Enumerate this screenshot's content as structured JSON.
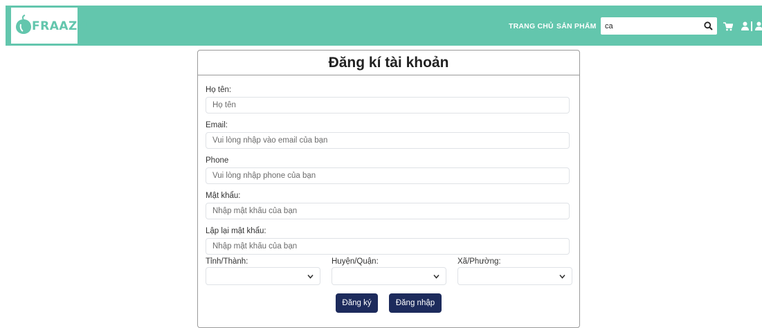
{
  "header": {
    "logo_text": "FRAAZO",
    "nav": {
      "home": "TRANG CHỦ",
      "products": "SẢN PHẨM"
    },
    "search": {
      "value": "ca"
    },
    "brand_color": "#63c6ad"
  },
  "form": {
    "title": "Đăng kí tài khoản",
    "fields": {
      "name": {
        "label": "Họ tên:",
        "placeholder": "Họ tên"
      },
      "email": {
        "label": "Email:",
        "placeholder": "Vui lòng nhập vào email của bạn"
      },
      "phone": {
        "label": "Phone",
        "placeholder": "Vui lòng nhập phone của bạn"
      },
      "password": {
        "label": "Mật khẩu:",
        "placeholder": "Nhập mật khẩu của bạn"
      },
      "confirm_password": {
        "label": "Lập lại mật khẩu:",
        "placeholder": "Nhập mật khẩu của bạn"
      }
    },
    "selects": {
      "province": {
        "label": "Tỉnh/Thành:",
        "value": ""
      },
      "district": {
        "label": "Huyện/Quận:",
        "value": ""
      },
      "ward": {
        "label": "Xã/Phường:",
        "value": ""
      }
    },
    "buttons": {
      "register": "Đăng ký",
      "login": "Đăng nhập"
    },
    "button_color": "#1d2b5c"
  },
  "icons": {
    "search": "search-icon",
    "cart": "cart-icon",
    "user": "user-icon",
    "logo": "logo-mark-icon",
    "select_arrow": "chevron-down-icon"
  }
}
